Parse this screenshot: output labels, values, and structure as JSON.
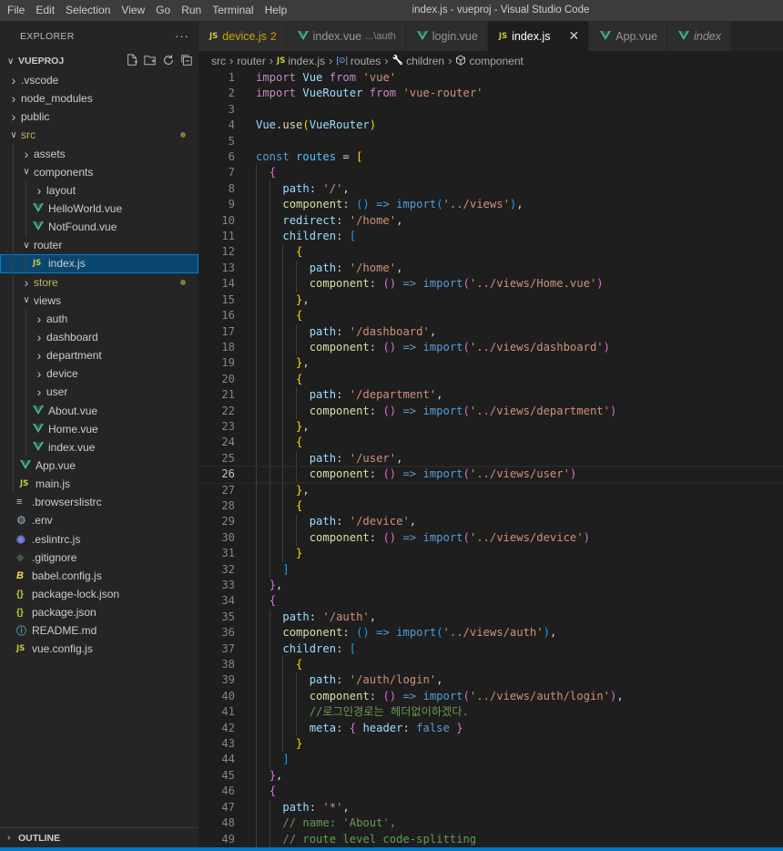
{
  "menu": [
    "File",
    "Edit",
    "Selection",
    "View",
    "Go",
    "Run",
    "Terminal",
    "Help"
  ],
  "window_title": "index.js - vueproj - Visual Studio Code",
  "explorer": {
    "title": "EXPLORER",
    "more": "···",
    "project": "VUEPROJ",
    "outline": "OUTLINE",
    "tree": [
      {
        "name": ".vscode",
        "type": "folder",
        "depth": 0,
        "open": false
      },
      {
        "name": "node_modules",
        "type": "folder",
        "depth": 0,
        "open": false
      },
      {
        "name": "public",
        "type": "folder",
        "depth": 0,
        "open": false
      },
      {
        "name": "src",
        "type": "folder",
        "depth": 0,
        "open": true,
        "modified": true
      },
      {
        "name": "assets",
        "type": "folder",
        "depth": 1,
        "open": false
      },
      {
        "name": "components",
        "type": "folder",
        "depth": 1,
        "open": true
      },
      {
        "name": "layout",
        "type": "folder",
        "depth": 2,
        "open": false
      },
      {
        "name": "HelloWorld.vue",
        "type": "vue",
        "depth": 2
      },
      {
        "name": "NotFound.vue",
        "type": "vue",
        "depth": 2
      },
      {
        "name": "router",
        "type": "folder",
        "depth": 1,
        "open": true
      },
      {
        "name": "index.js",
        "type": "js",
        "depth": 2,
        "selected": true
      },
      {
        "name": "store",
        "type": "folder",
        "depth": 1,
        "open": false,
        "modified": true
      },
      {
        "name": "views",
        "type": "folder",
        "depth": 1,
        "open": true
      },
      {
        "name": "auth",
        "type": "folder",
        "depth": 2,
        "open": false
      },
      {
        "name": "dashboard",
        "type": "folder",
        "depth": 2,
        "open": false
      },
      {
        "name": "department",
        "type": "folder",
        "depth": 2,
        "open": false
      },
      {
        "name": "device",
        "type": "folder",
        "depth": 2,
        "open": false
      },
      {
        "name": "user",
        "type": "folder",
        "depth": 2,
        "open": false
      },
      {
        "name": "About.vue",
        "type": "vue",
        "depth": 2
      },
      {
        "name": "Home.vue",
        "type": "vue",
        "depth": 2
      },
      {
        "name": "index.vue",
        "type": "vue",
        "depth": 2
      },
      {
        "name": "App.vue",
        "type": "vue",
        "depth": 1
      },
      {
        "name": "main.js",
        "type": "js",
        "depth": 1
      },
      {
        "name": ".browserslistrc",
        "type": "lines",
        "depth": 0
      },
      {
        "name": ".env",
        "type": "gear",
        "depth": 0
      },
      {
        "name": ".eslintrc.js",
        "type": "eslint",
        "depth": 0
      },
      {
        "name": ".gitignore",
        "type": "git",
        "depth": 0
      },
      {
        "name": "babel.config.js",
        "type": "babel",
        "depth": 0
      },
      {
        "name": "package-lock.json",
        "type": "json",
        "depth": 0
      },
      {
        "name": "package.json",
        "type": "json",
        "depth": 0
      },
      {
        "name": "README.md",
        "type": "info",
        "depth": 0
      },
      {
        "name": "vue.config.js",
        "type": "js",
        "depth": 0
      }
    ]
  },
  "tabs": [
    {
      "label": "device.js",
      "badge": "2",
      "icon": "js",
      "warn": true
    },
    {
      "label": "index.vue",
      "desc": "...\\auth",
      "icon": "vue"
    },
    {
      "label": "login.vue",
      "icon": "vue"
    },
    {
      "label": "index.js",
      "icon": "js",
      "active": true,
      "close": "✕"
    },
    {
      "label": "App.vue",
      "icon": "vue"
    },
    {
      "label": "index",
      "icon": "vue",
      "italic": true
    }
  ],
  "breadcrumb": [
    {
      "label": "src"
    },
    {
      "label": "router"
    },
    {
      "label": "index.js",
      "icon": "JS"
    },
    {
      "label": "routes",
      "icon": "[⊙]"
    },
    {
      "label": "children",
      "icon": "wrench"
    },
    {
      "label": "component",
      "icon": "cube"
    }
  ],
  "current_line": 26,
  "code": [
    [
      [
        "kw",
        "import"
      ],
      [
        "p",
        " "
      ],
      [
        "var",
        "Vue"
      ],
      [
        "p",
        " "
      ],
      [
        "kw",
        "from"
      ],
      [
        "p",
        " "
      ],
      [
        "str",
        "'vue'"
      ]
    ],
    [
      [
        "kw",
        "import"
      ],
      [
        "p",
        " "
      ],
      [
        "var",
        "VueRouter"
      ],
      [
        "p",
        " "
      ],
      [
        "kw",
        "from"
      ],
      [
        "p",
        " "
      ],
      [
        "str",
        "'vue-router'"
      ]
    ],
    [],
    [
      [
        "var",
        "Vue"
      ],
      [
        "p",
        "."
      ],
      [
        "fn",
        "use"
      ],
      [
        "b1",
        "("
      ],
      [
        "var",
        "VueRouter"
      ],
      [
        "b1",
        ")"
      ]
    ],
    [],
    [
      [
        "kw2",
        "const"
      ],
      [
        "p",
        " "
      ],
      [
        "const",
        "routes"
      ],
      [
        "p",
        " = "
      ],
      [
        "b1",
        "["
      ]
    ],
    [
      [
        "p",
        "  "
      ],
      [
        "b2",
        "{"
      ]
    ],
    [
      [
        "p",
        "    "
      ],
      [
        "var",
        "path"
      ],
      [
        "p",
        ": "
      ],
      [
        "str",
        "'/'"
      ],
      [
        "p",
        ","
      ]
    ],
    [
      [
        "p",
        "    "
      ],
      [
        "fn",
        "component"
      ],
      [
        "p",
        ": "
      ],
      [
        "b3",
        "()"
      ],
      [
        "p",
        " "
      ],
      [
        "kw2",
        "=>"
      ],
      [
        "p",
        " "
      ],
      [
        "kw2",
        "import"
      ],
      [
        "b3",
        "("
      ],
      [
        "str",
        "'../views'"
      ],
      [
        "b3",
        ")"
      ],
      [
        "p",
        ","
      ]
    ],
    [
      [
        "p",
        "    "
      ],
      [
        "var",
        "redirect"
      ],
      [
        "p",
        ": "
      ],
      [
        "str",
        "'/home'"
      ],
      [
        "p",
        ","
      ]
    ],
    [
      [
        "p",
        "    "
      ],
      [
        "var",
        "children"
      ],
      [
        "p",
        ": "
      ],
      [
        "b3",
        "["
      ]
    ],
    [
      [
        "p",
        "      "
      ],
      [
        "b1",
        "{"
      ]
    ],
    [
      [
        "p",
        "        "
      ],
      [
        "var",
        "path"
      ],
      [
        "p",
        ": "
      ],
      [
        "str",
        "'/home'"
      ],
      [
        "p",
        ","
      ]
    ],
    [
      [
        "p",
        "        "
      ],
      [
        "fn",
        "component"
      ],
      [
        "p",
        ": "
      ],
      [
        "b2",
        "()"
      ],
      [
        "p",
        " "
      ],
      [
        "kw2",
        "=>"
      ],
      [
        "p",
        " "
      ],
      [
        "kw2",
        "import"
      ],
      [
        "b2",
        "("
      ],
      [
        "str",
        "'../views/Home.vue'"
      ],
      [
        "b2",
        ")"
      ]
    ],
    [
      [
        "p",
        "      "
      ],
      [
        "b1",
        "}"
      ],
      [
        "p",
        ","
      ]
    ],
    [
      [
        "p",
        "      "
      ],
      [
        "b1",
        "{"
      ]
    ],
    [
      [
        "p",
        "        "
      ],
      [
        "var",
        "path"
      ],
      [
        "p",
        ": "
      ],
      [
        "str",
        "'/dashboard'"
      ],
      [
        "p",
        ","
      ]
    ],
    [
      [
        "p",
        "        "
      ],
      [
        "fn",
        "component"
      ],
      [
        "p",
        ": "
      ],
      [
        "b2",
        "()"
      ],
      [
        "p",
        " "
      ],
      [
        "kw2",
        "=>"
      ],
      [
        "p",
        " "
      ],
      [
        "kw2",
        "import"
      ],
      [
        "b2",
        "("
      ],
      [
        "str",
        "'../views/dashboard'"
      ],
      [
        "b2",
        ")"
      ]
    ],
    [
      [
        "p",
        "      "
      ],
      [
        "b1",
        "}"
      ],
      [
        "p",
        ","
      ]
    ],
    [
      [
        "p",
        "      "
      ],
      [
        "b1",
        "{"
      ]
    ],
    [
      [
        "p",
        "        "
      ],
      [
        "var",
        "path"
      ],
      [
        "p",
        ": "
      ],
      [
        "str",
        "'/department'"
      ],
      [
        "p",
        ","
      ]
    ],
    [
      [
        "p",
        "        "
      ],
      [
        "fn",
        "component"
      ],
      [
        "p",
        ": "
      ],
      [
        "b2",
        "()"
      ],
      [
        "p",
        " "
      ],
      [
        "kw2",
        "=>"
      ],
      [
        "p",
        " "
      ],
      [
        "kw2",
        "import"
      ],
      [
        "b2",
        "("
      ],
      [
        "str",
        "'../views/department'"
      ],
      [
        "b2",
        ")"
      ]
    ],
    [
      [
        "p",
        "      "
      ],
      [
        "b1",
        "}"
      ],
      [
        "p",
        ","
      ]
    ],
    [
      [
        "p",
        "      "
      ],
      [
        "b1",
        "{"
      ]
    ],
    [
      [
        "p",
        "        "
      ],
      [
        "var",
        "path"
      ],
      [
        "p",
        ": "
      ],
      [
        "str",
        "'/user'"
      ],
      [
        "p",
        ","
      ]
    ],
    [
      [
        "p",
        "        "
      ],
      [
        "fn",
        "component"
      ],
      [
        "p",
        ": "
      ],
      [
        "b2",
        "()"
      ],
      [
        "p",
        " "
      ],
      [
        "kw2",
        "=>"
      ],
      [
        "p",
        " "
      ],
      [
        "kw2",
        "import"
      ],
      [
        "b2",
        "("
      ],
      [
        "str",
        "'../views/user'"
      ],
      [
        "b2",
        ")"
      ]
    ],
    [
      [
        "p",
        "      "
      ],
      [
        "b1",
        "}"
      ],
      [
        "p",
        ","
      ]
    ],
    [
      [
        "p",
        "      "
      ],
      [
        "b1",
        "{"
      ]
    ],
    [
      [
        "p",
        "        "
      ],
      [
        "var",
        "path"
      ],
      [
        "p",
        ": "
      ],
      [
        "str",
        "'/device'"
      ],
      [
        "p",
        ","
      ]
    ],
    [
      [
        "p",
        "        "
      ],
      [
        "fn",
        "component"
      ],
      [
        "p",
        ": "
      ],
      [
        "b2",
        "()"
      ],
      [
        "p",
        " "
      ],
      [
        "kw2",
        "=>"
      ],
      [
        "p",
        " "
      ],
      [
        "kw2",
        "import"
      ],
      [
        "b2",
        "("
      ],
      [
        "str",
        "'../views/device'"
      ],
      [
        "b2",
        ")"
      ]
    ],
    [
      [
        "p",
        "      "
      ],
      [
        "b1",
        "}"
      ]
    ],
    [
      [
        "p",
        "    "
      ],
      [
        "b3",
        "]"
      ]
    ],
    [
      [
        "p",
        "  "
      ],
      [
        "b2",
        "}"
      ],
      [
        "p",
        ","
      ]
    ],
    [
      [
        "p",
        "  "
      ],
      [
        "b2",
        "{"
      ]
    ],
    [
      [
        "p",
        "    "
      ],
      [
        "var",
        "path"
      ],
      [
        "p",
        ": "
      ],
      [
        "str",
        "'/auth'"
      ],
      [
        "p",
        ","
      ]
    ],
    [
      [
        "p",
        "    "
      ],
      [
        "fn",
        "component"
      ],
      [
        "p",
        ": "
      ],
      [
        "b3",
        "()"
      ],
      [
        "p",
        " "
      ],
      [
        "kw2",
        "=>"
      ],
      [
        "p",
        " "
      ],
      [
        "kw2",
        "import"
      ],
      [
        "b3",
        "("
      ],
      [
        "str",
        "'../views/auth'"
      ],
      [
        "b3",
        ")"
      ],
      [
        "p",
        ","
      ]
    ],
    [
      [
        "p",
        "    "
      ],
      [
        "var",
        "children"
      ],
      [
        "p",
        ": "
      ],
      [
        "b3",
        "["
      ]
    ],
    [
      [
        "p",
        "      "
      ],
      [
        "b1",
        "{"
      ]
    ],
    [
      [
        "p",
        "        "
      ],
      [
        "var",
        "path"
      ],
      [
        "p",
        ": "
      ],
      [
        "str",
        "'/auth/login'"
      ],
      [
        "p",
        ","
      ]
    ],
    [
      [
        "p",
        "        "
      ],
      [
        "fn",
        "component"
      ],
      [
        "p",
        ": "
      ],
      [
        "b2",
        "()"
      ],
      [
        "p",
        " "
      ],
      [
        "kw2",
        "=>"
      ],
      [
        "p",
        " "
      ],
      [
        "kw2",
        "import"
      ],
      [
        "b2",
        "("
      ],
      [
        "str",
        "'../views/auth/login'"
      ],
      [
        "b2",
        ")"
      ],
      [
        "p",
        ","
      ]
    ],
    [
      [
        "p",
        "        "
      ],
      [
        "cmt",
        "//로그인경로는 헤더없이하겠다."
      ]
    ],
    [
      [
        "p",
        "        "
      ],
      [
        "var",
        "meta"
      ],
      [
        "p",
        ": "
      ],
      [
        "b2",
        "{"
      ],
      [
        "p",
        " "
      ],
      [
        "var",
        "header"
      ],
      [
        "p",
        ": "
      ],
      [
        "kw2",
        "false"
      ],
      [
        "p",
        " "
      ],
      [
        "b2",
        "}"
      ]
    ],
    [
      [
        "p",
        "      "
      ],
      [
        "b1",
        "}"
      ]
    ],
    [
      [
        "p",
        "    "
      ],
      [
        "b3",
        "]"
      ]
    ],
    [
      [
        "p",
        "  "
      ],
      [
        "b2",
        "}"
      ],
      [
        "p",
        ","
      ]
    ],
    [
      [
        "p",
        "  "
      ],
      [
        "b2",
        "{"
      ]
    ],
    [
      [
        "p",
        "    "
      ],
      [
        "var",
        "path"
      ],
      [
        "p",
        ": "
      ],
      [
        "str",
        "'*'"
      ],
      [
        "p",
        ","
      ]
    ],
    [
      [
        "p",
        "    "
      ],
      [
        "cmt",
        "// name: 'About',"
      ]
    ],
    [
      [
        "p",
        "    "
      ],
      [
        "cmt",
        "// route level code-splitting"
      ]
    ]
  ],
  "colors": {
    "accent": "#007acc",
    "selection": "#094771",
    "vue_green": "#41b883",
    "js_yellow": "#cbcb41"
  }
}
